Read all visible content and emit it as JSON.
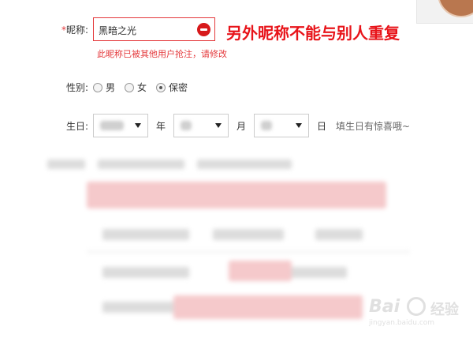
{
  "nickname": {
    "label_required": "*",
    "label": "昵称:",
    "value": "黑暗之光",
    "error_message": "此昵称已被其他用户抢注，请修改",
    "annotation": "另外昵称不能与别人重复"
  },
  "gender": {
    "label": "性别:",
    "options": [
      {
        "label": "男",
        "checked": false
      },
      {
        "label": "女",
        "checked": false
      },
      {
        "label": "保密",
        "checked": true
      }
    ]
  },
  "birthday": {
    "label": "生日:",
    "year_unit": "年",
    "month_unit": "月",
    "day_unit": "日",
    "hint": "填生日有惊喜哦~"
  },
  "watermark": {
    "brand": "Bai",
    "brand_cn": "经验",
    "url": "jingyan.baidu.com"
  },
  "colors": {
    "error": "#e4393c",
    "annotation": "#e8141a"
  },
  "icons": [
    "error-minus-icon",
    "dropdown-arrow-icon",
    "radio-icon"
  ]
}
